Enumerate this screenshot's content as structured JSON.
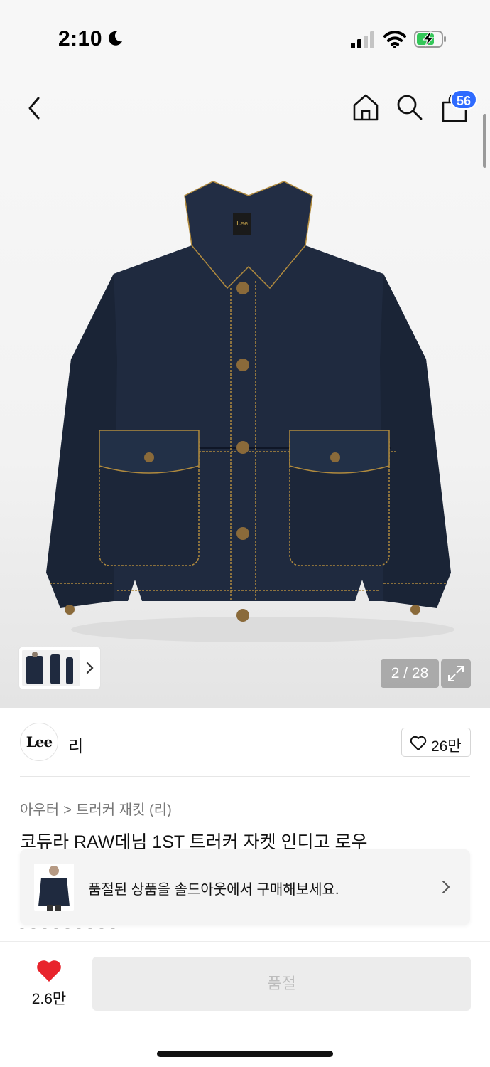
{
  "status_bar": {
    "time": "2:10"
  },
  "header": {
    "cart_count": "56"
  },
  "gallery": {
    "page_counter": "2 / 28"
  },
  "brand": {
    "logo_text": "Lee",
    "name": "리",
    "like_count": "26만"
  },
  "breadcrumb": {
    "category": "아우터",
    "separator": ">",
    "subcategory": "트러커 재킷 (리)"
  },
  "product": {
    "title": "코듀라 RAW데님 1ST 트러커 자켓 인디고 로우"
  },
  "soldout_banner": {
    "message": "품절된 상품을 솔드아웃에서 구매해보세요."
  },
  "bottom_bar": {
    "wish_count": "2.6만",
    "soldout_label": "품절"
  },
  "colors": {
    "accent_blue": "#2f6bff",
    "heart_red": "#e8242c",
    "denim": "#1f2a3f",
    "stitch": "#b08a3e"
  }
}
